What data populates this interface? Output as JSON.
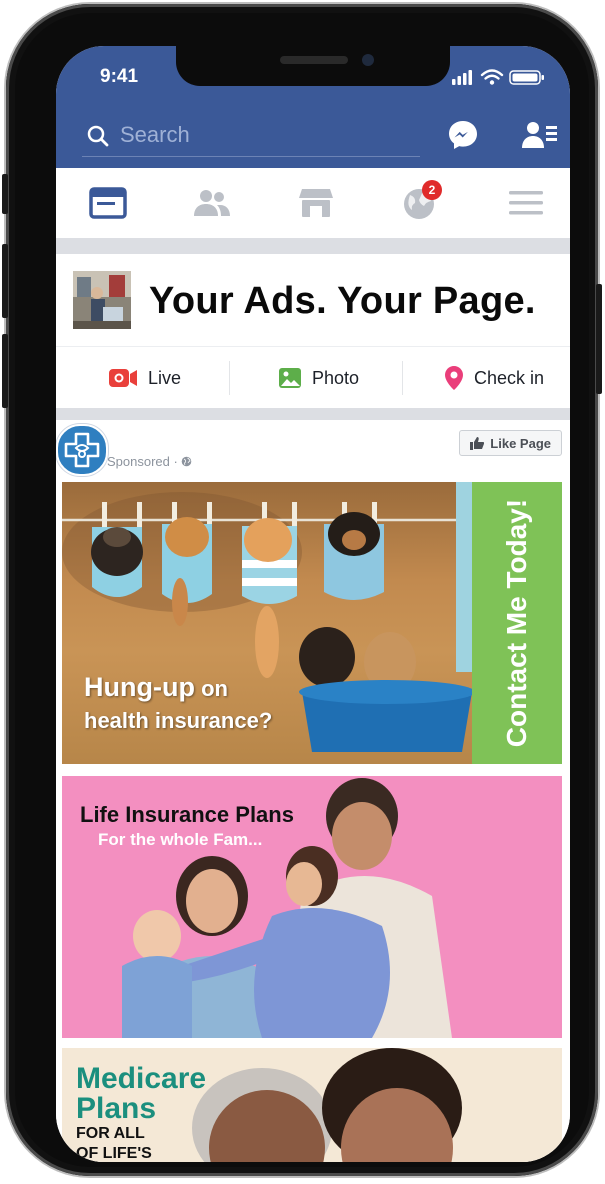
{
  "status_bar": {
    "time": "9:41"
  },
  "search": {
    "placeholder": "Search"
  },
  "tabs": {
    "notifications_badge": "2"
  },
  "composer": {
    "headline": "Your Ads. Your Page."
  },
  "actions": [
    {
      "label": "Live"
    },
    {
      "label": "Photo"
    },
    {
      "label": "Check in"
    }
  ],
  "post": {
    "sponsored_label": "Sponsored ·",
    "like_page_label": "Like Page",
    "ad1": {
      "headline_bold": "Hung-up",
      "headline_rest": " on",
      "subline": "health insurance?",
      "cta": "Contact Me Today!"
    },
    "ad2": {
      "title": "Life Insurance Plans",
      "subtitle": "For the whole Fam..."
    },
    "ad3": {
      "title_line1": "Medicare",
      "title_line2": "Plans",
      "line3": "FOR ALL",
      "line4": "OF LIFE'S"
    }
  },
  "colors": {
    "facebook_blue": "#3b5998",
    "cta_green": "#7fc257",
    "ad2_pink": "#f38fc0",
    "medicare_teal": "#1b8f7e",
    "badge_red": "#e02b2b"
  }
}
